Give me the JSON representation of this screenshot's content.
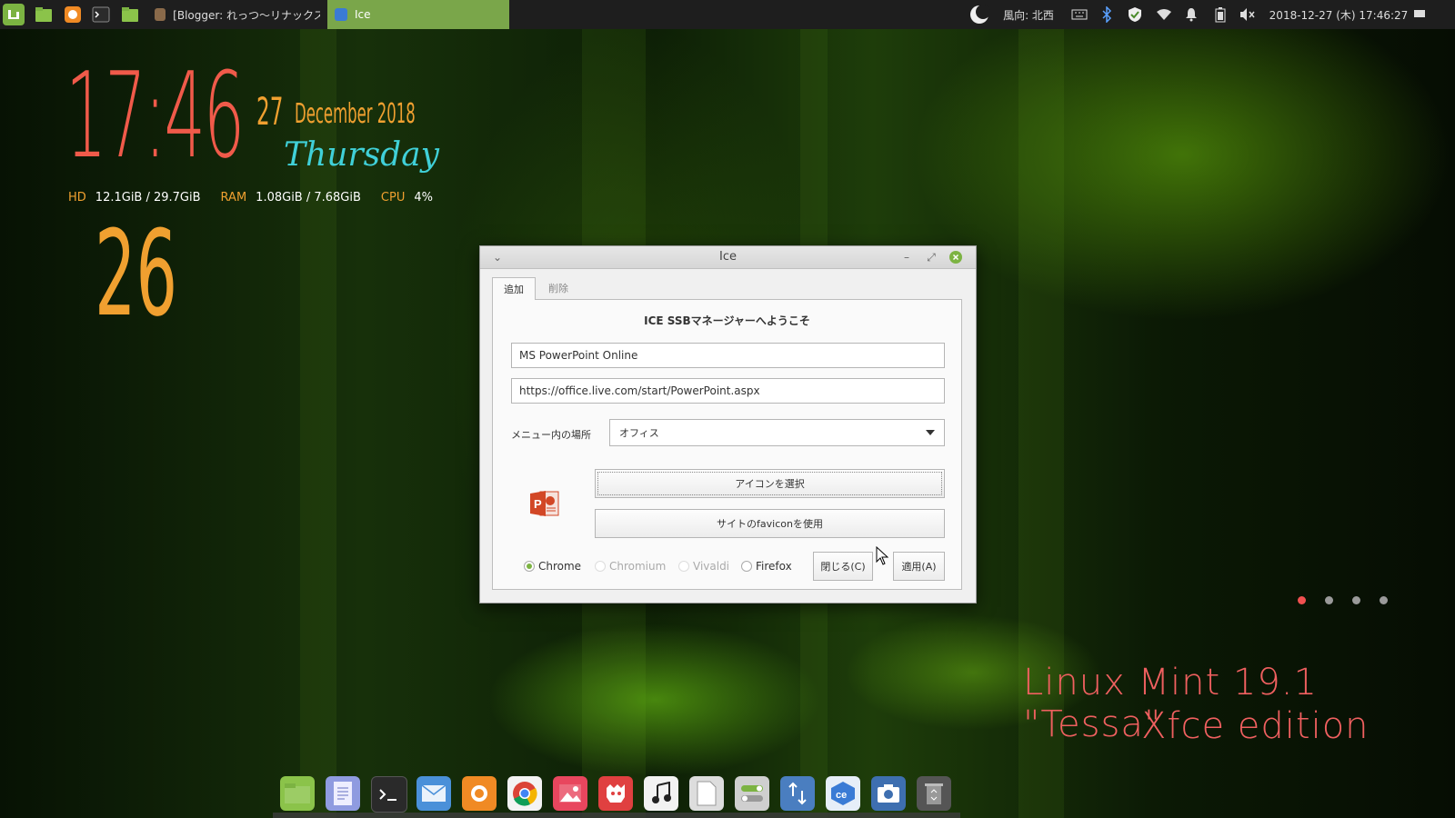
{
  "taskbar": {
    "tasks": [
      {
        "label": "[Blogger: れっつ～リナックス! ...",
        "icon": "firefox-icon"
      },
      {
        "label": "Ice",
        "icon": "ice-icon",
        "active": true
      }
    ],
    "weather": "風向: 北西",
    "datetime": "2018-12-27 (木) 17:46:27"
  },
  "conky": {
    "time": "17:46",
    "day": "27",
    "month_year": "December 2018",
    "weekday": "Thursday",
    "hd_label": "HD",
    "hd_value": "12.1GiB / 29.7GiB",
    "ram_label": "RAM",
    "ram_value": "1.08GiB / 7.68GiB",
    "cpu_label": "CPU",
    "cpu_value": "4%",
    "week_number": "26"
  },
  "dialog": {
    "title": "Ice",
    "tabs": {
      "add": "追加",
      "remove": "削除"
    },
    "welcome": "ICE SSBマネージャーへようこそ",
    "name_value": "MS PowerPoint Online",
    "url_value": "https://office.live.com/start/PowerPoint.aspx",
    "location_label": "メニュー内の場所",
    "location_value": "オフィス",
    "pick_icon_label": "アイコンを選択",
    "favicon_label": "サイトのfaviconを使用",
    "browsers": {
      "chrome": "Chrome",
      "chromium": "Chromium",
      "vivaldi": "Vivaldi",
      "firefox": "Firefox"
    },
    "close_label": "閉じる(C)",
    "apply_label": "適用(A)"
  },
  "edition": {
    "line1": "Linux Mint 19.1 \"Tessa\"",
    "line2": "Xfce edition"
  },
  "colors": {
    "accent": "#7cb342",
    "conky_orange": "#f0a030",
    "conky_red": "#f05a4a",
    "conky_cyan": "#40d0d8",
    "edition": "#f06060"
  }
}
